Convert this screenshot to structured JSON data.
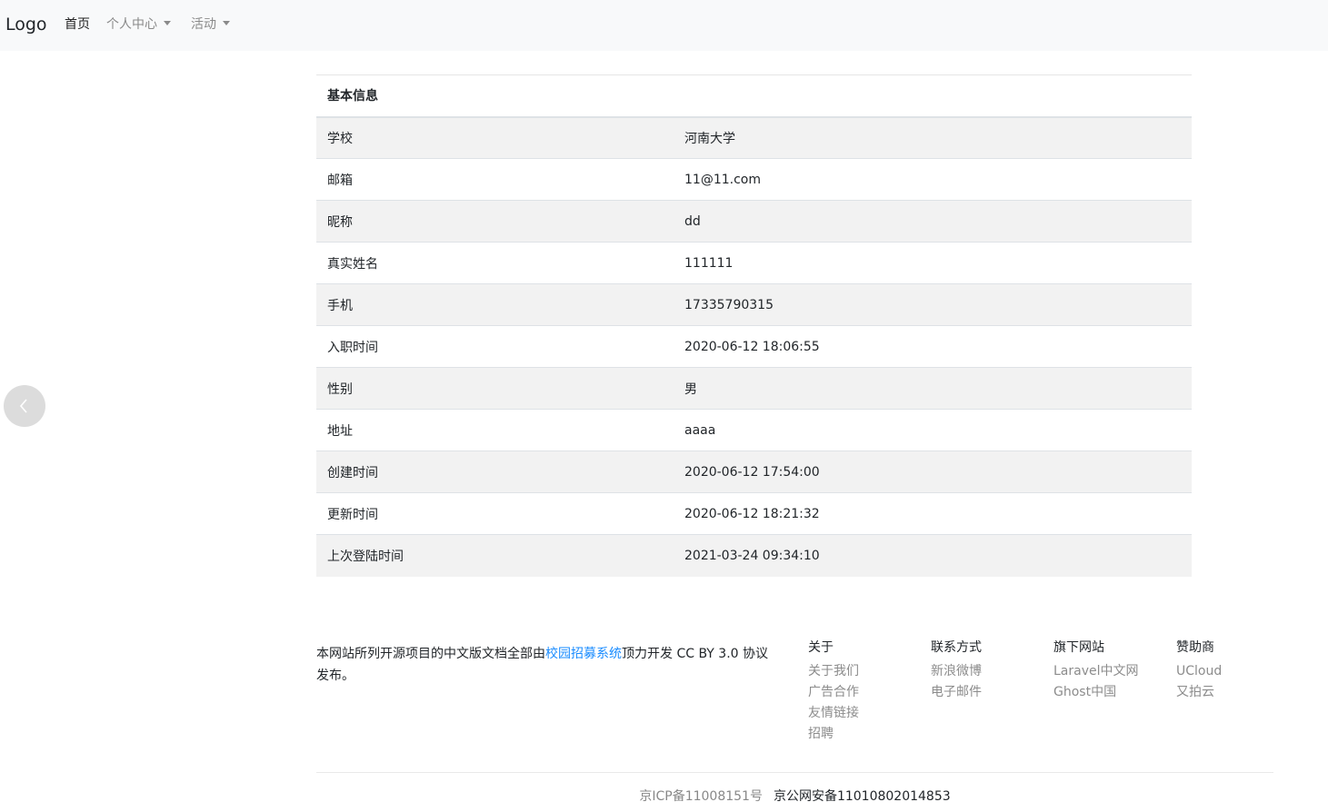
{
  "navbar": {
    "brand": "Logo",
    "items": [
      {
        "label": "首页"
      },
      {
        "label": "个人中心"
      },
      {
        "label": "活动"
      }
    ]
  },
  "table": {
    "header": "基本信息",
    "rows": [
      {
        "label": "学校",
        "value": "河南大学"
      },
      {
        "label": "邮箱",
        "value": "11@11.com"
      },
      {
        "label": "昵称",
        "value": "dd"
      },
      {
        "label": "真实姓名",
        "value": "111111"
      },
      {
        "label": "手机",
        "value": "17335790315"
      },
      {
        "label": "入职时间",
        "value": "2020-06-12 18:06:55"
      },
      {
        "label": "性别",
        "value": "男"
      },
      {
        "label": "地址",
        "value": "aaaa"
      },
      {
        "label": "创建时间",
        "value": "2020-06-12 17:54:00"
      },
      {
        "label": "更新时间",
        "value": "2020-06-12 18:21:32"
      },
      {
        "label": "上次登陆时间",
        "value": "2021-03-24 09:34:10"
      }
    ]
  },
  "footer": {
    "desc_prefix": "本网站所列开源项目的中文版文档全部由",
    "desc_link": "校园招募系统",
    "desc_suffix": "顶力开发 CC BY 3.0 协议发布。",
    "columns": [
      {
        "heading": "关于",
        "items": [
          "关于我们",
          "广告合作",
          "友情链接",
          "招聘"
        ]
      },
      {
        "heading": "联系方式",
        "items": [
          "新浪微博",
          "电子邮件"
        ]
      },
      {
        "heading": "旗下网站",
        "items": [
          "Laravel中文网",
          "Ghost中国"
        ]
      },
      {
        "heading": "赞助商",
        "items": [
          "UCloud",
          "又拍云"
        ]
      }
    ],
    "icp": "京ICP备11008151号",
    "police": "京公网安备11010802014853"
  }
}
